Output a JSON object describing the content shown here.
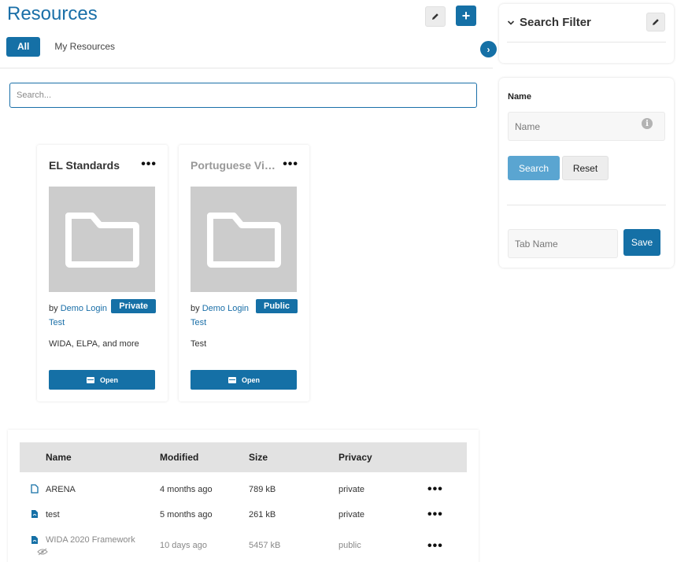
{
  "header": {
    "title": "Resources",
    "edit_icon": "pencil-icon",
    "add_label": "+"
  },
  "tabs": [
    {
      "label": "All",
      "active": true
    },
    {
      "label": "My Resources",
      "active": false
    }
  ],
  "collapse_label": "›",
  "search": {
    "placeholder": "Search...",
    "value": ""
  },
  "cards": [
    {
      "title": "EL Standards",
      "more": "•••",
      "by": "by",
      "author_first": "Demo Login",
      "author_last": "Test",
      "badge": "Private",
      "description": "WIDA, ELPA, and more",
      "open_label": "Open"
    },
    {
      "title": "Portuguese Vid...",
      "more": "•••",
      "by": "by",
      "author_first": "Demo Login",
      "author_last": "Test",
      "badge": "Public",
      "description": "Test",
      "open_label": "Open"
    }
  ],
  "table": {
    "headers": {
      "name": "Name",
      "modified": "Modified",
      "size": "Size",
      "privacy": "Privacy"
    },
    "rows": [
      {
        "name": "ARENA",
        "modified": "4 months ago",
        "size": "789 kB",
        "privacy": "private",
        "icon": "file-icon",
        "more": "•••"
      },
      {
        "name": "test",
        "modified": "5 months ago",
        "size": "261 kB",
        "privacy": "private",
        "icon": "pdf-icon",
        "more": "•••"
      },
      {
        "name": "WIDA 2020 Framework",
        "modified": "10 days ago",
        "size": "5457 kB",
        "privacy": "public",
        "icon": "pdf-icon",
        "more": "•••"
      }
    ]
  },
  "search_filter": {
    "title": "Search Filter",
    "name_label": "Name",
    "name_placeholder": "Name",
    "info_label": "i",
    "search_label": "Search",
    "reset_label": "Reset",
    "tab_name_placeholder": "Tab Name",
    "save_label": "Save"
  },
  "colors": {
    "primary": "#1570a6",
    "primary_light": "#5aa5d1",
    "link": "#1a6fa8"
  }
}
